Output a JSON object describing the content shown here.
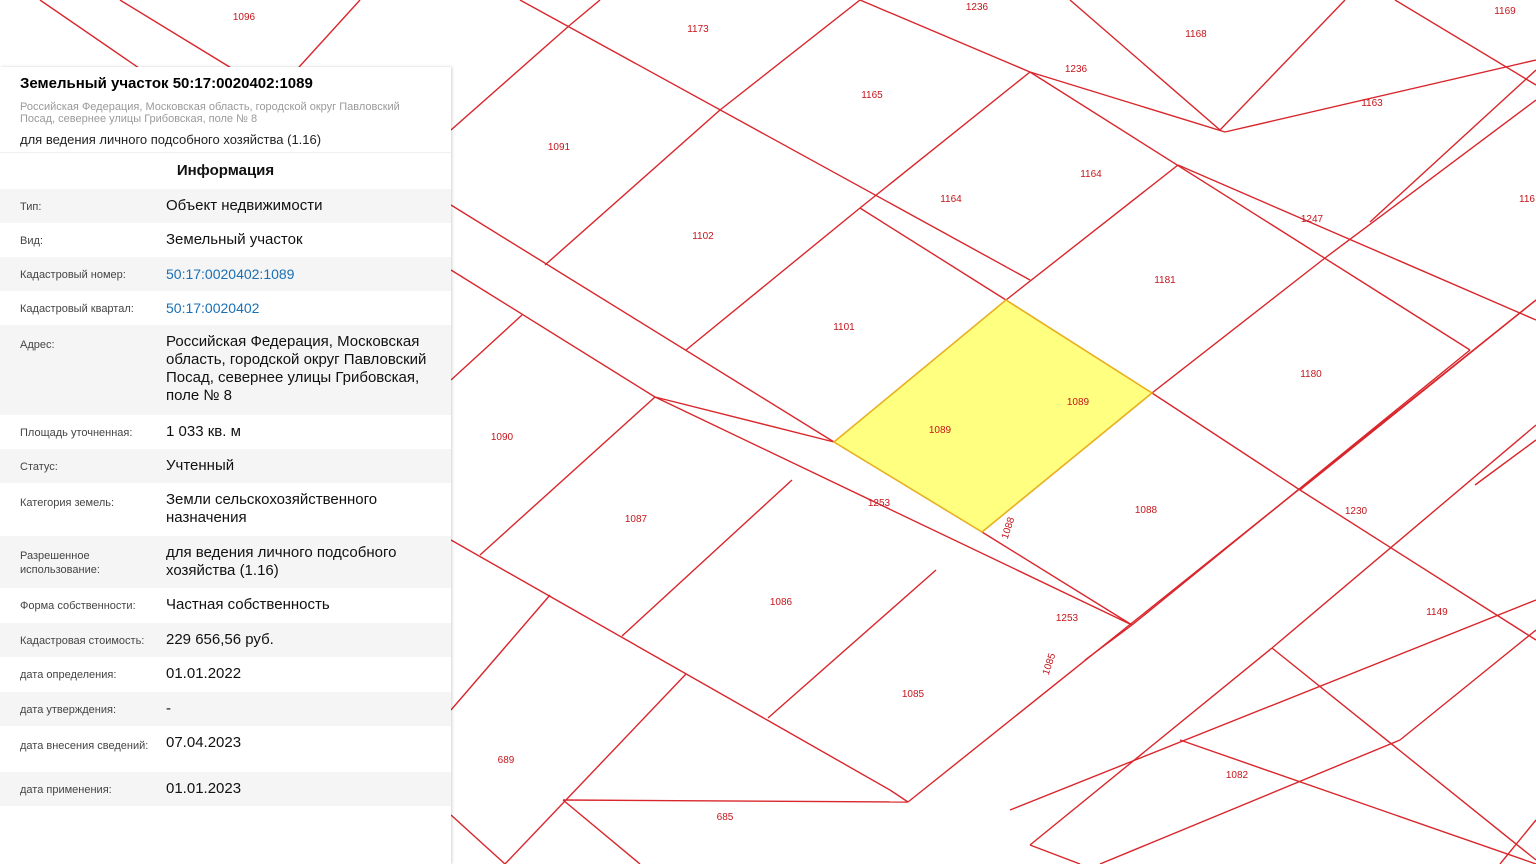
{
  "panel": {
    "title": "Земельный участок 50:17:0020402:1089",
    "address": "Российская Федерация, Московская область, городской округ Павловский Посад, севернее улицы Грибовская, поле № 8",
    "use": "для ведения личного подсобного хозяйства (1.16)",
    "section": "Информация",
    "rows": [
      {
        "key": "Тип:",
        "value": "Объект недвижимости"
      },
      {
        "key": "Вид:",
        "value": "Земельный участок"
      },
      {
        "key": "Кадастровый номер:",
        "value": "50:17:0020402:1089",
        "link": true
      },
      {
        "key": "Кадастровый квартал:",
        "value": "50:17:0020402",
        "link": true
      },
      {
        "key": "Адрес:",
        "value": "Российская Федерация, Московская область, городской округ Павловский Посад, севернее улицы Грибовская, поле № 8"
      },
      {
        "key": "Площадь уточненная:",
        "value": "1 033 кв. м"
      },
      {
        "key": "Статус:",
        "value": "Учтенный"
      },
      {
        "key": "Категория земель:",
        "value": "Земли сельскохозяйственного назначения"
      },
      {
        "key": "Разрешенное использование:",
        "value": "для ведения личного подсобного хозяйства (1.16)"
      },
      {
        "key": "Форма собственности:",
        "value": "Частная собственность"
      },
      {
        "key": "Кадастровая стоимость:",
        "value": "229 656,56 руб."
      },
      {
        "key": "дата определения:",
        "value": "01.01.2022"
      },
      {
        "key": "дата утверждения:",
        "value": "-"
      },
      {
        "key": "дата внесения сведений:",
        "value": "07.04.2023"
      },
      {
        "key": "дата применения:",
        "value": "01.01.2023"
      }
    ]
  },
  "map": {
    "line_color": "#d9262c",
    "highlight_fill": "#ffff80",
    "highlight_stroke": "#e8b020",
    "selected_parcel": "1089",
    "parcel_labels": [
      "1096",
      "1236",
      "1169",
      "1173",
      "1168",
      "1236",
      "1165",
      "1163",
      "1091",
      "1164",
      "1164",
      "1247",
      "1102",
      "1181",
      "1101",
      "1089",
      "1089",
      "1180",
      "1090",
      "1253",
      "1088",
      "1088",
      "1087",
      "1230",
      "1086",
      "1253",
      "1149",
      "1085",
      "1085",
      "689",
      "1082",
      "685",
      "116"
    ]
  }
}
